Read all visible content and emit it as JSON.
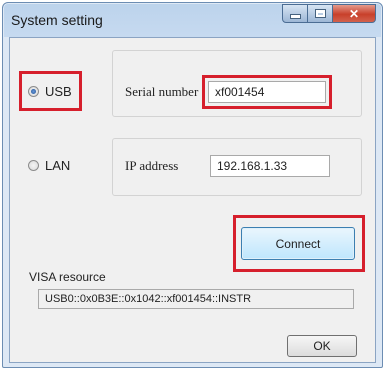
{
  "window": {
    "title": "System setting"
  },
  "usb": {
    "label": "USB",
    "selected": true,
    "serial_label": "Serial number",
    "serial_value": "xf001454"
  },
  "lan": {
    "label": "LAN",
    "selected": false,
    "ip_label": "IP address",
    "ip_value": "192.168.1.33"
  },
  "actions": {
    "connect_label": "Connect",
    "ok_label": "OK"
  },
  "visa": {
    "label": "VISA resource",
    "value": "USB0::0x0B3E::0x1042::xf001454::INSTR"
  },
  "accent_colors": {
    "highlight": "#d61f2c",
    "close_button": "#c8402b"
  },
  "icons": {
    "minimize": "minimize-icon",
    "maximize": "maximize-icon",
    "close": "close-icon"
  }
}
